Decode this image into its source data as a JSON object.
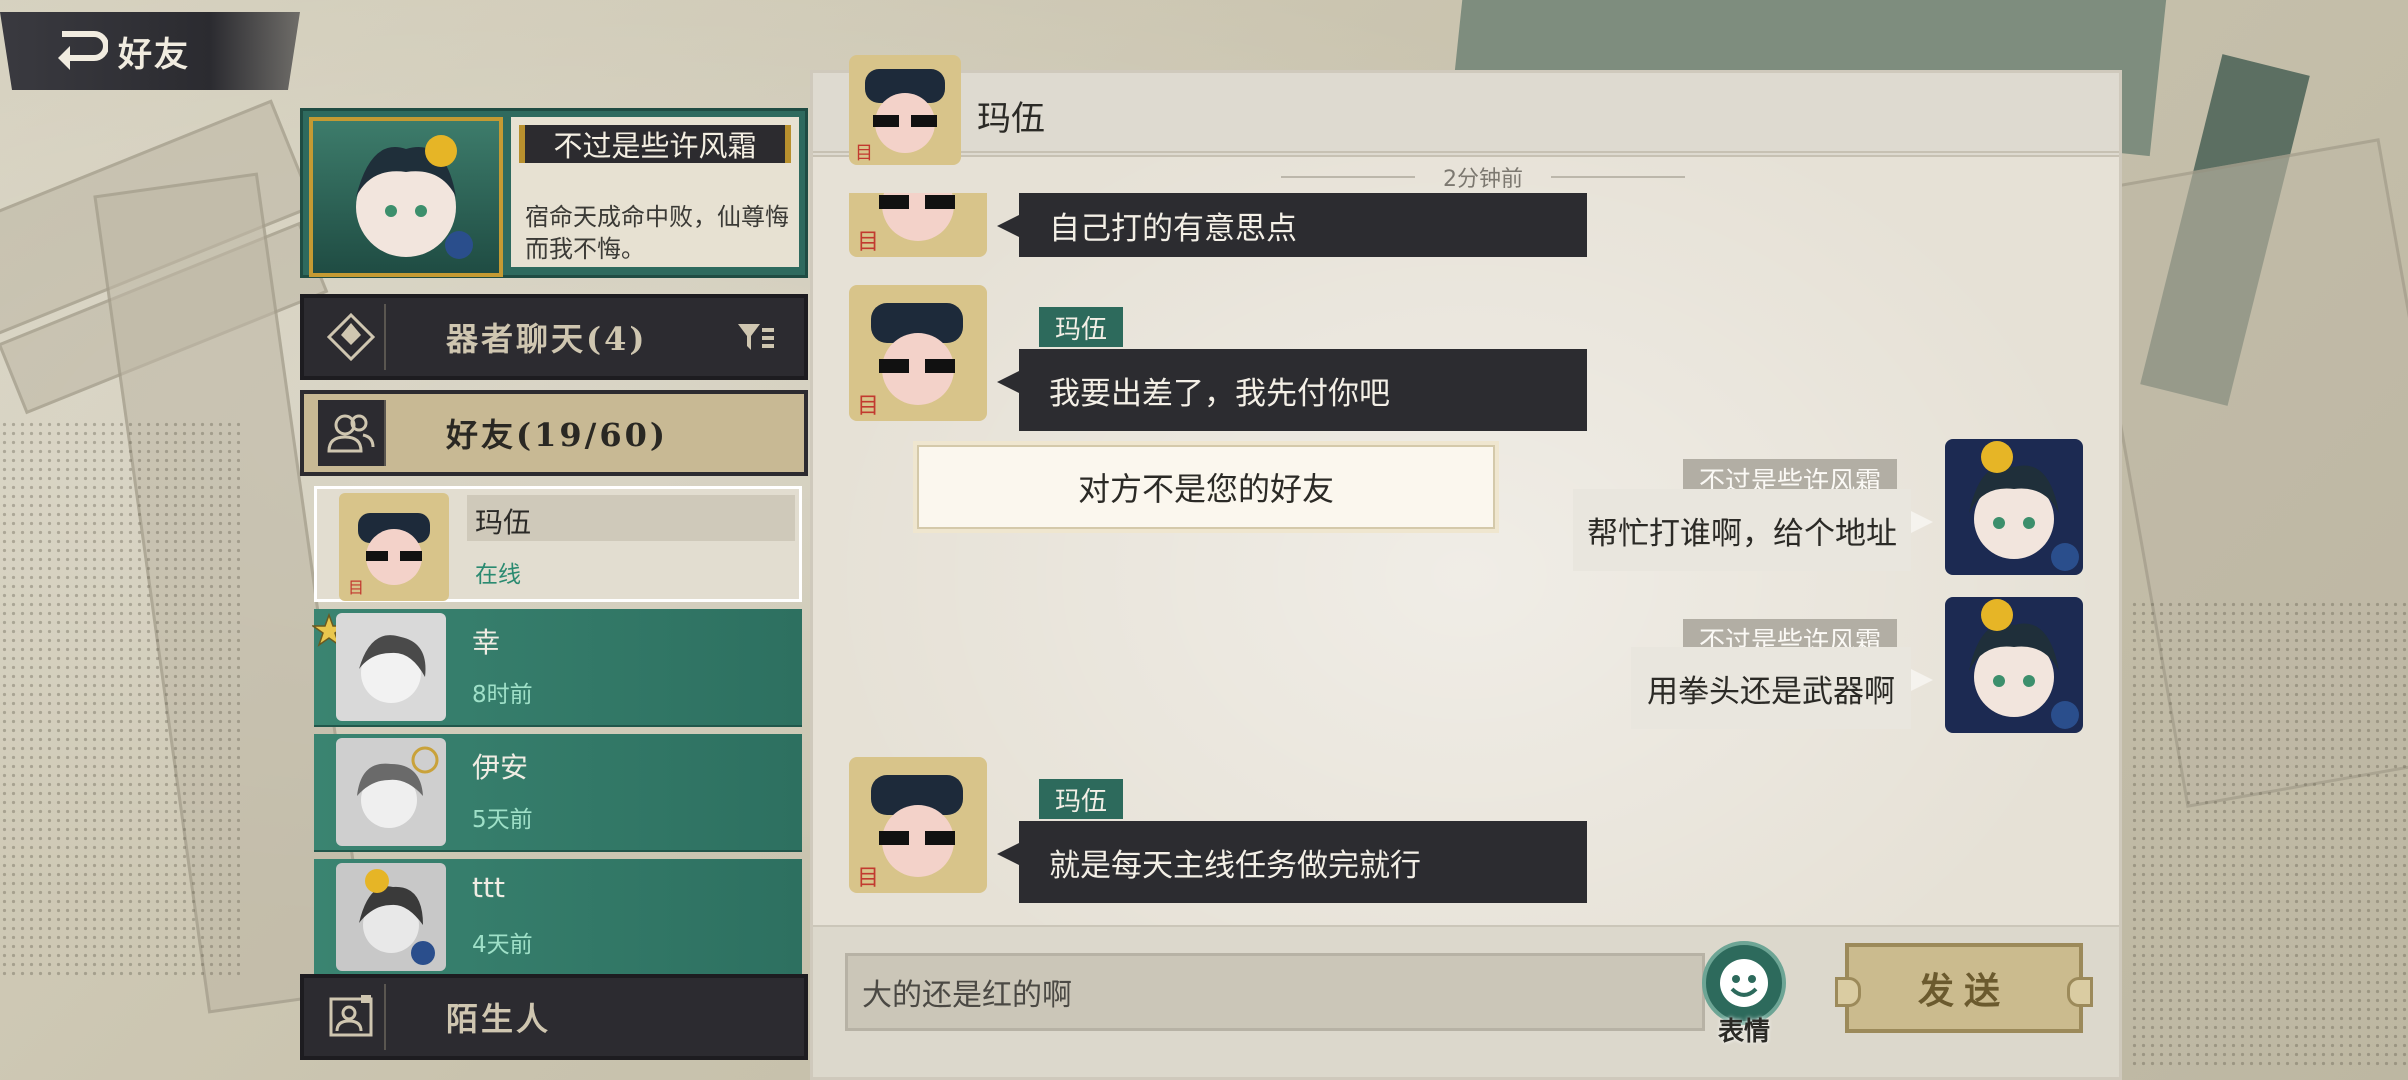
{
  "topbar": {
    "title": "好友"
  },
  "profile": {
    "name": "不过是些许风霜",
    "signature": "宿命天成命中败，仙尊悔而我不悔。"
  },
  "categories": [
    {
      "label": "器者聊天(4)"
    },
    {
      "label": "好友(19/60)"
    },
    {
      "label": "陌生人"
    }
  ],
  "friends": [
    {
      "name": "玛伍",
      "status": "在线"
    },
    {
      "name": "幸",
      "status": "8时前"
    },
    {
      "name": "伊安",
      "status": "5天前"
    },
    {
      "name": "ttt",
      "status": "4天前"
    }
  ],
  "chat": {
    "partner_name": "玛伍",
    "time_label": "2分钟前",
    "messages": [
      {
        "side": "left",
        "sender": "",
        "text": "自己打的有意思点"
      },
      {
        "side": "left",
        "sender": "玛伍",
        "text": "我要出差了，我先付你吧"
      },
      {
        "side": "right",
        "sender": "不过是些许风霜",
        "text": "帮忙打谁啊，给个地址"
      },
      {
        "side": "right",
        "sender": "不过是些许风霜",
        "text": "用拳头还是武器啊"
      },
      {
        "side": "left",
        "sender": "玛伍",
        "text": "就是每天主线任务做完就行"
      }
    ],
    "notice": "对方不是您的好友"
  },
  "input": {
    "value": "大的还是红的啊"
  },
  "buttons": {
    "emote": "表情",
    "send": "发送"
  },
  "colors": {
    "teal": "#2d6a5c",
    "dark": "#2c2c30",
    "gold": "#c49a33"
  }
}
